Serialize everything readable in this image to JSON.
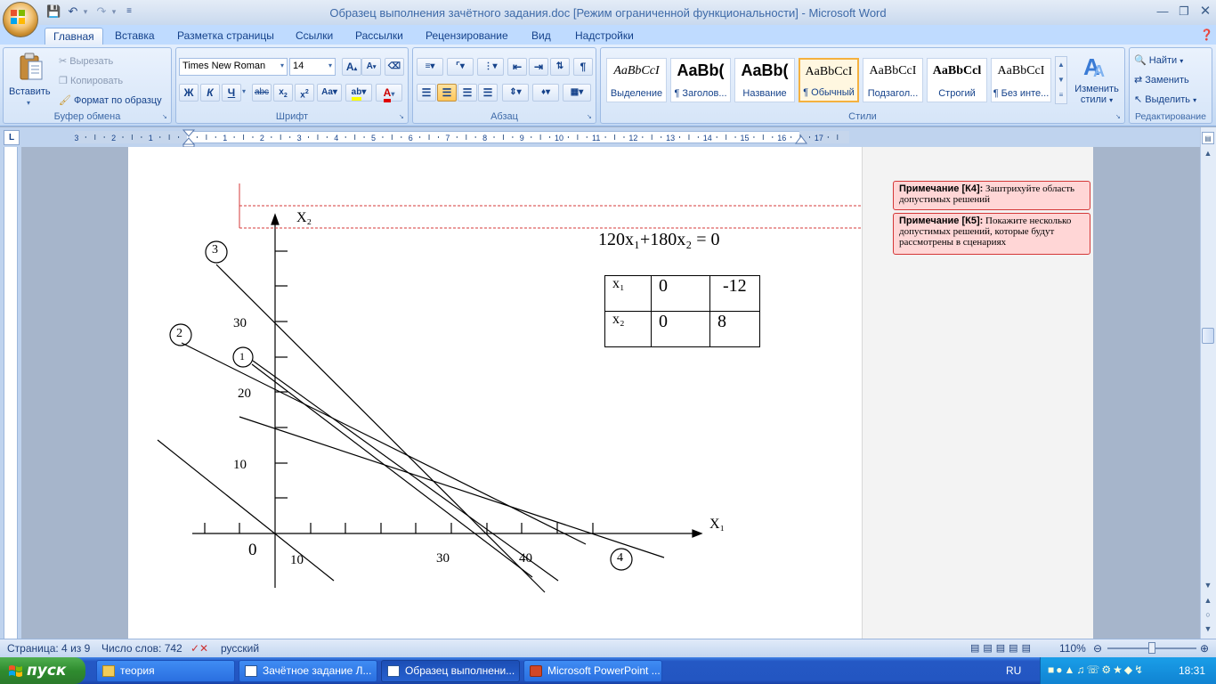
{
  "window": {
    "title": "Образец выполнения зачётного задания.doc [Режим ограниченной функциональности] - Microsoft Word"
  },
  "ribbon_tabs": [
    "Главная",
    "Вставка",
    "Разметка страницы",
    "Ссылки",
    "Рассылки",
    "Рецензирование",
    "Вид",
    "Надстройки"
  ],
  "clipboard": {
    "label": "Буфер обмена",
    "paste": "Вставить",
    "cut": "Вырезать",
    "copy": "Копировать",
    "format_painter": "Формат по образцу"
  },
  "font": {
    "label": "Шрифт",
    "name": "Times New Roman",
    "size": "14"
  },
  "paragraph": {
    "label": "Абзац"
  },
  "styles": {
    "label": "Стили",
    "items": [
      {
        "sample": "AaBbCcI",
        "name": "Выделение"
      },
      {
        "sample": "AaBb(",
        "name": "¶ Заголов..."
      },
      {
        "sample": "AaBb(",
        "name": "Название"
      },
      {
        "sample": "AaBbCcI",
        "name": "¶ Обычный"
      },
      {
        "sample": "AaBbCcI",
        "name": "Подзагол..."
      },
      {
        "sample": "AaBbCcl",
        "name": "Строгий"
      },
      {
        "sample": "AaBbCcI",
        "name": "¶ Без инте..."
      }
    ],
    "change": "Изменить",
    "change2": "стили"
  },
  "editing": {
    "label": "Редактирование",
    "find": "Найти",
    "replace": "Заменить",
    "select": "Выделить"
  },
  "ruler": {
    "numbers": [
      "3",
      "2",
      "1",
      "1",
      "2",
      "3",
      "4",
      "5",
      "6",
      "7",
      "8",
      "9",
      "10",
      "11",
      "12",
      "13",
      "14",
      "15",
      "16",
      "17"
    ]
  },
  "document": {
    "equation": "120x₁+180x₂ = 0",
    "table": [
      [
        "x₁",
        "0",
        "-12"
      ],
      [
        "x₂",
        "0",
        "8"
      ]
    ],
    "graph": {
      "x_axis_label": "X₁",
      "y_axis_label": "X₂",
      "origin": "0",
      "x_ticks": [
        "10",
        "30",
        "40"
      ],
      "y_ticks": [
        "30",
        "20",
        "10"
      ],
      "line_labels": [
        "1",
        "2",
        "3",
        "4"
      ]
    }
  },
  "comments": [
    {
      "title": "Примечание [К4]:",
      "text": "Заштрихуйте область допустимых решений"
    },
    {
      "title": "Примечание [К5]:",
      "text": "Покажите несколько допустимых решений, которые будут рассмотрены в сценариях"
    }
  ],
  "status": {
    "page": "Страница: 4 из 9",
    "words": "Число слов: 742",
    "language": "русский",
    "zoom": "110%"
  },
  "taskbar": {
    "start": "пуск",
    "tasks": [
      "теория",
      "Зачётное задание Л...",
      "Образец выполнени...",
      "Microsoft PowerPoint ..."
    ],
    "lang": "RU",
    "clock": "18:31"
  },
  "colors": {
    "accent": "#15428b",
    "ribbon_bg": "#d2e2f7",
    "comment_bg": "#ffd6d6",
    "comment_border": "#d43838",
    "taskbar": "#2356c2",
    "start": "#2f8c2f",
    "style_selected": "#f4b13f"
  },
  "icons": [
    "office-button-icon",
    "save-icon",
    "undo-icon",
    "redo-icon",
    "scissors-icon",
    "copy-icon",
    "brush-icon",
    "find-icon",
    "replace-icon",
    "select-icon",
    "change-styles-icon",
    "windows-flag-icon",
    "folder-icon",
    "word-doc-icon",
    "powerpoint-icon"
  ]
}
